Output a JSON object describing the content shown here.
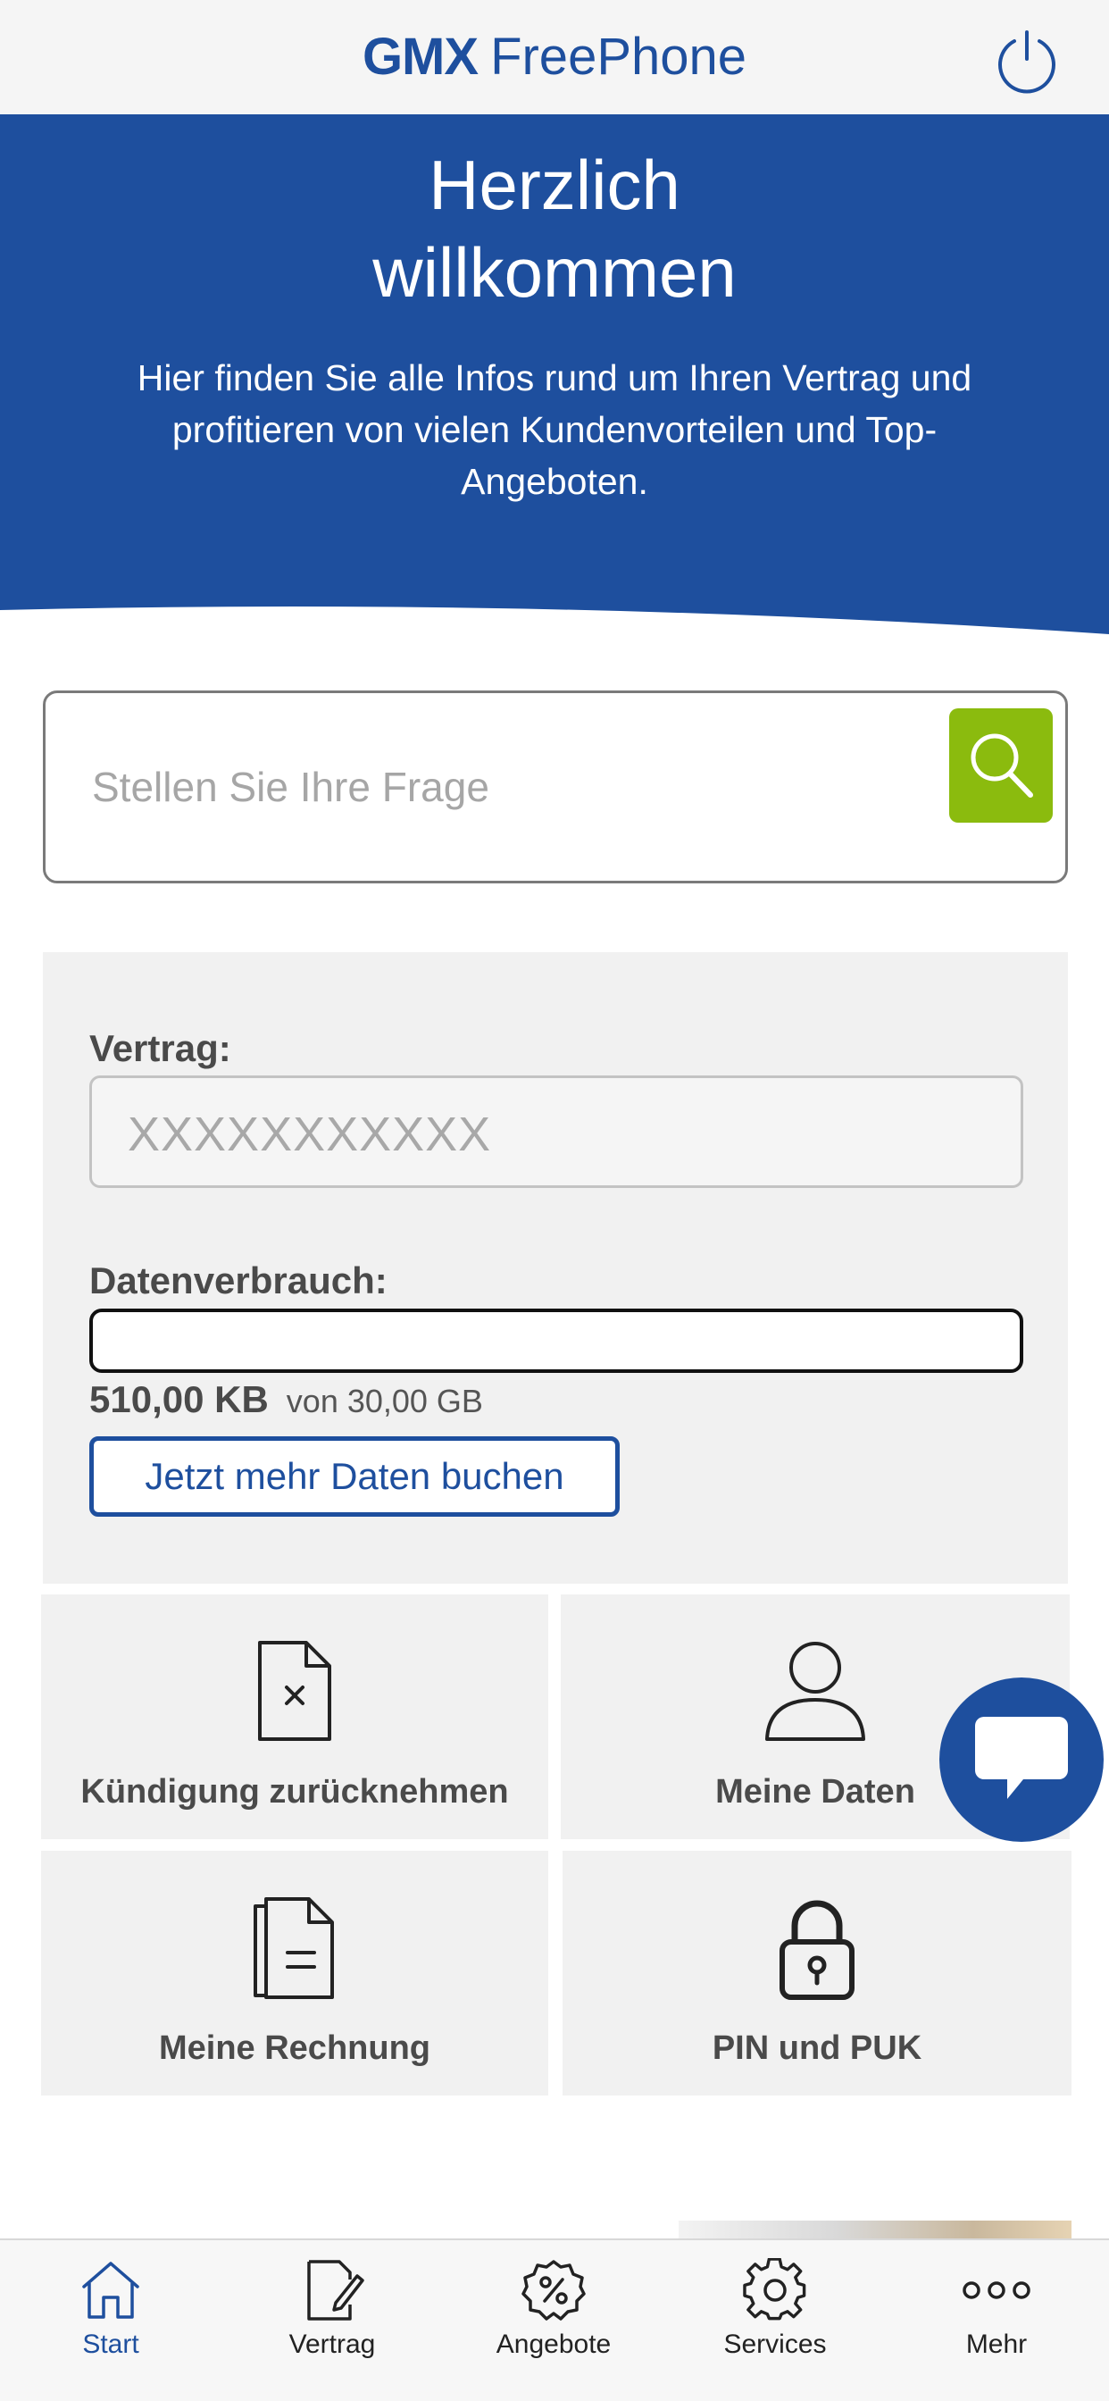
{
  "app": {
    "brand_bold": "GMX",
    "brand_light": "FreePhone"
  },
  "hero": {
    "title_line1": "Herzlich",
    "title_line2": "willkommen",
    "text": "Hier finden Sie alle Infos rund um Ihren Vertrag und profitieren von vielen Kundenvorteilen und Top-Angeboten."
  },
  "search": {
    "placeholder": "Stellen Sie Ihre Frage",
    "value": ""
  },
  "contract": {
    "label": "Vertrag:",
    "number": "XXXXXXXXXXX",
    "usage_label": "Datenverbrauch:",
    "used": "510,00 KB",
    "total": "von 30,00 GB",
    "used_fraction": 0.0,
    "book_more_label": "Jetzt mehr Daten buchen"
  },
  "tiles": [
    {
      "label": "Kündigung zurücknehmen",
      "icon": "document-x-icon"
    },
    {
      "label": "Meine Daten",
      "icon": "person-icon"
    },
    {
      "label": "Meine Rechnung",
      "icon": "invoice-icon"
    },
    {
      "label": "PIN und PUK",
      "icon": "lock-icon"
    }
  ],
  "nav": [
    {
      "label": "Start",
      "icon": "home-icon",
      "active": true
    },
    {
      "label": "Vertrag",
      "icon": "contract-edit-icon",
      "active": false
    },
    {
      "label": "Angebote",
      "icon": "percent-badge-icon",
      "active": false
    },
    {
      "label": "Services",
      "icon": "gear-icon",
      "active": false
    },
    {
      "label": "Mehr",
      "icon": "more-dots-icon",
      "active": false
    }
  ],
  "colors": {
    "brand_blue": "#1e4f9e",
    "search_green": "#8bbb0e",
    "panel_gray": "#f1f1f1"
  }
}
